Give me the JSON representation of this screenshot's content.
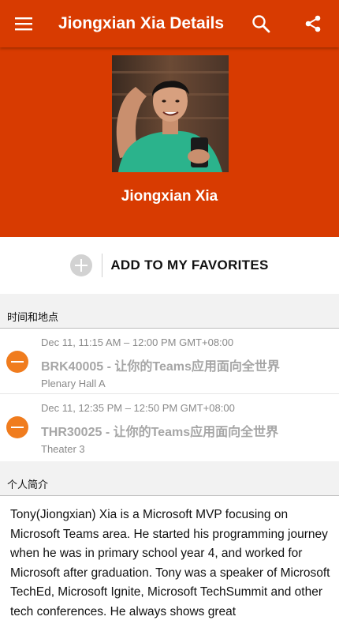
{
  "header": {
    "title": "Jiongxian Xia Details",
    "menu_icon": "hamburger-menu-icon",
    "search_icon": "search-icon",
    "share_icon": "share-icon",
    "background_color": "#d83b01"
  },
  "profile": {
    "name": "Jiongxian Xia",
    "photo": "speaker-photo"
  },
  "favorites": {
    "label": "ADD TO MY FAVORITES",
    "icon": "add-circle-icon"
  },
  "schedule": {
    "header": "时间和地点",
    "sessions": [
      {
        "time": "Dec 11, 11:15 AM – 12:00 PM GMT+08:00",
        "title": "BRK40005 - 让你的Teams应用面向全世界",
        "location": "Plenary Hall A"
      },
      {
        "time": "Dec 11, 12:35 PM – 12:50 PM GMT+08:00",
        "title": "THR30025 - 让你的Teams应用面向全世界",
        "location": "Theater 3"
      }
    ],
    "remove_icon": "remove-circle-icon",
    "remove_icon_color": "#f07c1e"
  },
  "bio": {
    "header": "个人简介",
    "text": "Tony(Jiongxian) Xia is a Microsoft MVP focusing on Microsoft Teams area. He started his programming journey when he was in primary school year 4, and worked for Microsoft after graduation. Tony was a speaker of Microsoft TechEd, Microsoft Ignite, Microsoft TechSummit and other tech conferences. He always shows great"
  }
}
